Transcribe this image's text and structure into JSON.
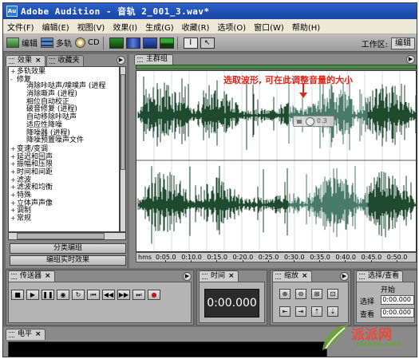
{
  "window": {
    "title": "Adobe Audition - 音轨 2_001_3.wav*",
    "app_icon": "Au"
  },
  "menu": [
    "文件(F)",
    "编辑(E)",
    "视图(V)",
    "效果(I)",
    "生成(G)",
    "收藏(R)",
    "选项(O)",
    "窗口(W)",
    "帮助(H)"
  ],
  "toolbar": {
    "edit_label": "编辑",
    "multitrack_label": "多轨",
    "cd_label": "CD",
    "workspace_label": "工作区:",
    "workspace_value": "编辑"
  },
  "left_panel": {
    "tabs": [
      "效果",
      "收藏夹"
    ],
    "tree": [
      {
        "level": 1,
        "expander": "+",
        "label": "多轨效果"
      },
      {
        "level": 1,
        "expander": "-",
        "label": "修复"
      },
      {
        "level": 2,
        "expander": "",
        "label": "消除咔哒声/噗噗声 (进程"
      },
      {
        "level": 2,
        "expander": "",
        "label": "消除嘶声 (进程)"
      },
      {
        "level": 2,
        "expander": "",
        "label": "相位自动校正"
      },
      {
        "level": 2,
        "expander": "",
        "label": "破音修复 (进程)"
      },
      {
        "level": 2,
        "expander": "",
        "label": "自动移除咔哒声"
      },
      {
        "level": 2,
        "expander": "",
        "label": "适应性降噪"
      },
      {
        "level": 2,
        "expander": "",
        "label": "降噪器 (进程)"
      },
      {
        "level": 2,
        "expander": "",
        "label": "降噪预置噪声文件"
      },
      {
        "level": 1,
        "expander": "+",
        "label": "变速/变调"
      },
      {
        "level": 1,
        "expander": "+",
        "label": "延迟和回声"
      },
      {
        "level": 1,
        "expander": "+",
        "label": "振幅和压限"
      },
      {
        "level": 1,
        "expander": "+",
        "label": "时间和间距"
      },
      {
        "level": 1,
        "expander": "+",
        "label": "滤波"
      },
      {
        "level": 1,
        "expander": "+",
        "label": "滤波和均衡"
      },
      {
        "level": 1,
        "expander": "+",
        "label": "特殊"
      },
      {
        "level": 1,
        "expander": "+",
        "label": "立体声声像"
      },
      {
        "level": 1,
        "expander": "+",
        "label": "调制"
      },
      {
        "level": 1,
        "expander": "+",
        "label": "常规"
      }
    ],
    "group_button": "分类编组",
    "realtime_button": "编组实时效果"
  },
  "main_panel": {
    "tab": "主群组",
    "annotation": "选取波形, 可在此调整音量的大小",
    "volume_value": "0.3",
    "ruler_unit": "hms",
    "ruler_labels": [
      "0:05.0",
      "0:10.0",
      "0:15.0",
      "0:20.0",
      "0:25.0",
      "0:30.0",
      "0:35.0",
      "0:40.0",
      "0:45.0",
      "0:50.0"
    ]
  },
  "transport": {
    "tab": "传送器"
  },
  "time": {
    "tab": "时间",
    "value": "0:00.000"
  },
  "zoom": {
    "tab": "缩放"
  },
  "selection": {
    "tab": "选择/查看",
    "start_header": "开始",
    "select_label": "选择",
    "view_label": "查看",
    "select_start": "0:00.000",
    "view_start": "0:00.000"
  },
  "levels": {
    "tab": "电平"
  },
  "watermark": {
    "brand": "派派网",
    "url": "pickee.com"
  },
  "colors": {
    "wave_green": "#1e4a2e",
    "wave_grey": "#4a7a6a",
    "annotation_red": "#e0261b"
  }
}
